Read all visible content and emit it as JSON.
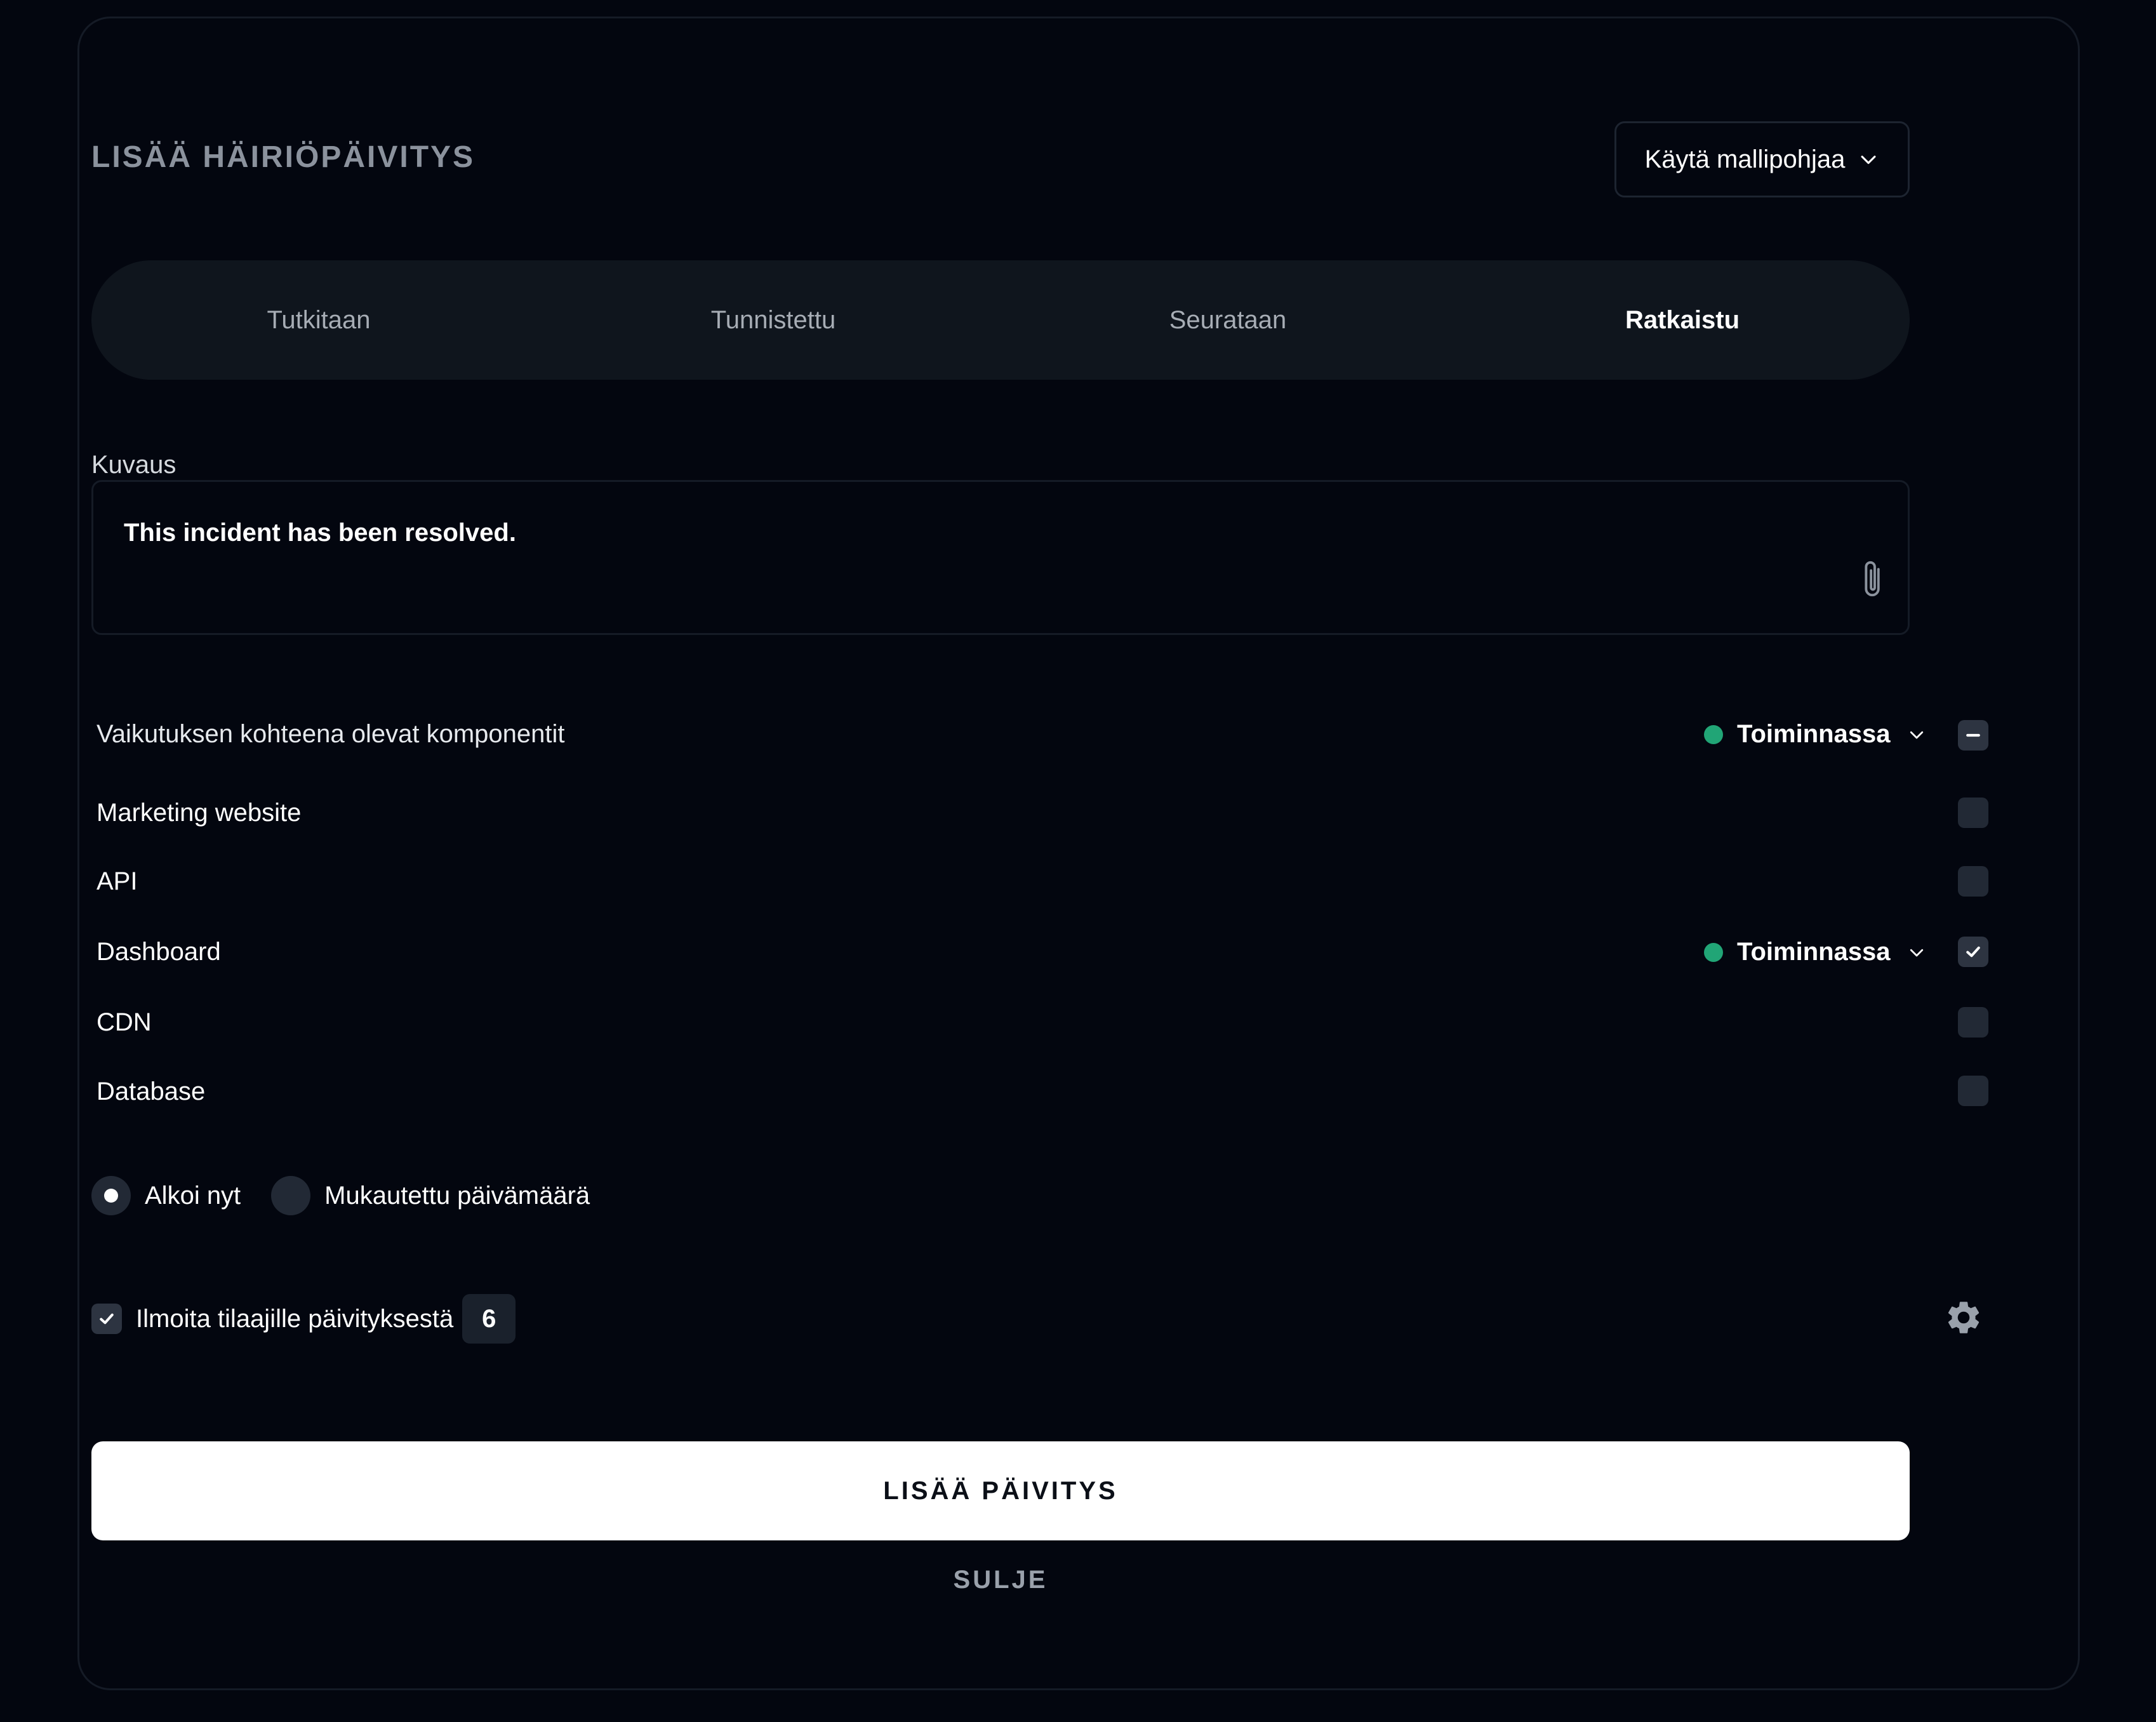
{
  "header": {
    "title": "LISÄÄ HÄIRIÖPÄIVITYS",
    "template_button": "Käytä mallipohjaa"
  },
  "tabs": [
    {
      "label": "Tutkitaan",
      "active": false
    },
    {
      "label": "Tunnistettu",
      "active": false
    },
    {
      "label": "Seurataan",
      "active": false
    },
    {
      "label": "Ratkaistu",
      "active": true
    }
  ],
  "description": {
    "label": "Kuvaus",
    "value": "This incident has been resolved."
  },
  "components": {
    "header_label": "Vaikutuksen kohteena olevat komponentit",
    "header_status": "Toiminnassa",
    "items": [
      {
        "name": "Marketing website",
        "checked": false,
        "status": ""
      },
      {
        "name": "API",
        "checked": false,
        "status": ""
      },
      {
        "name": "Dashboard",
        "checked": true,
        "status": "Toiminnassa"
      },
      {
        "name": "CDN",
        "checked": false,
        "status": ""
      },
      {
        "name": "Database",
        "checked": false,
        "status": ""
      }
    ]
  },
  "start_time": {
    "options": [
      {
        "label": "Alkoi nyt",
        "selected": true
      },
      {
        "label": "Mukautettu päivämäärä",
        "selected": false
      }
    ]
  },
  "notify": {
    "label": "Ilmoita tilaajille päivityksestä",
    "checked": true,
    "count": "6"
  },
  "actions": {
    "submit": "LISÄÄ PÄIVITYS",
    "close": "SULJE"
  },
  "colors": {
    "background": "#03060f",
    "tab_bar": "#0f151d",
    "status_green": "#21a576",
    "primary_button": "#ffffff"
  }
}
